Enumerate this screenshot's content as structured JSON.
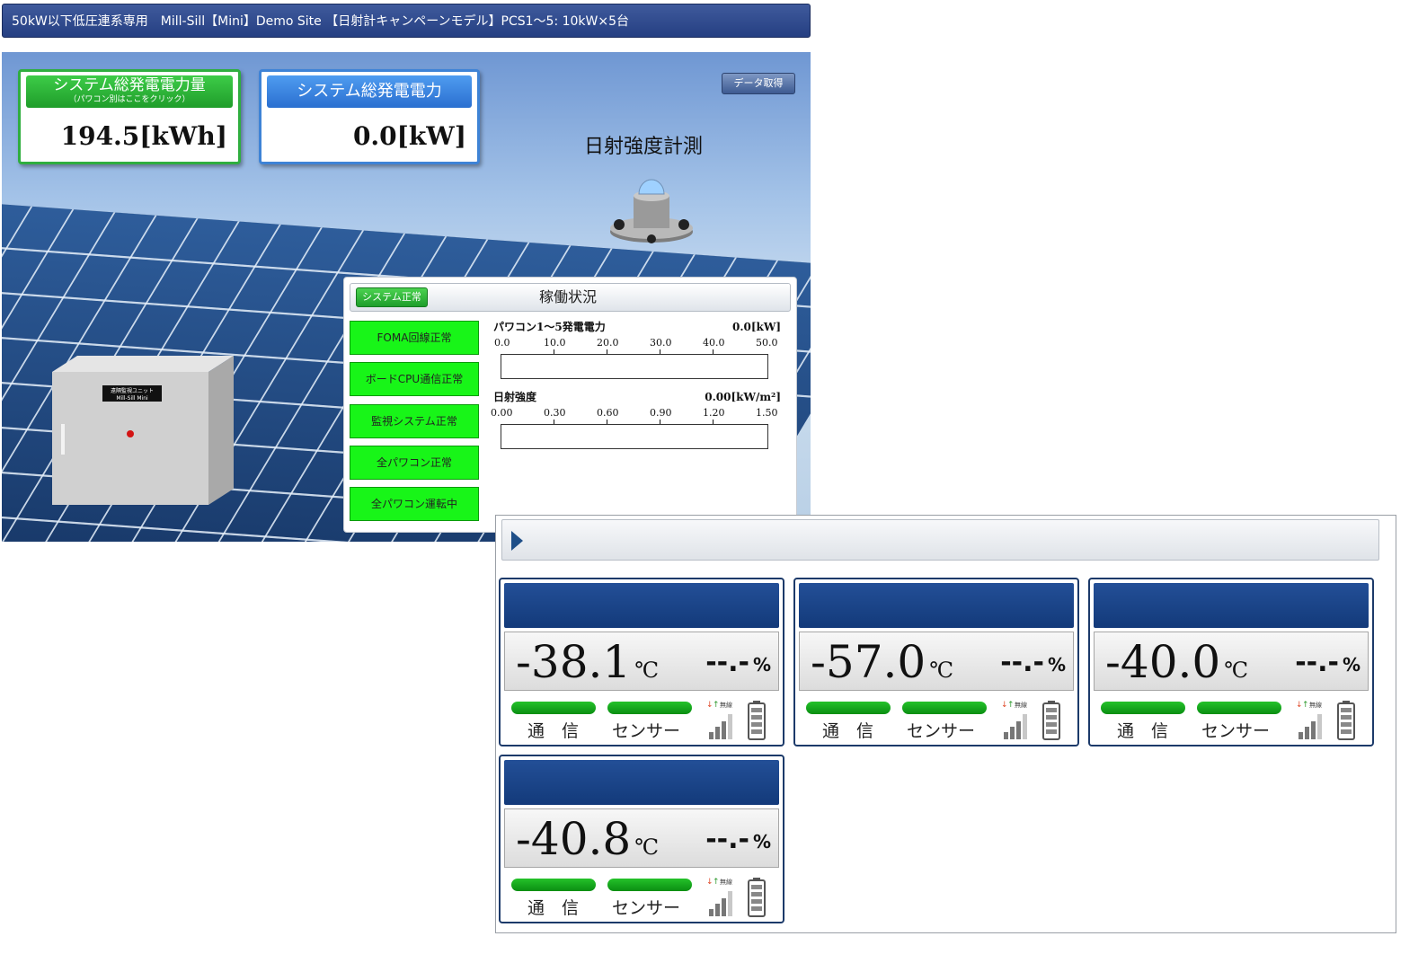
{
  "header": {
    "title": "50kW以下低圧連系専用　Mill-Sill【Mini】Demo Site 【日射計キャンペーンモデル】PCS1～5: 10kW×5台"
  },
  "summary": {
    "energy_label": "システム総発電電力量",
    "energy_sub": "（パワコン別はここをクリック）",
    "energy_value": "194.5[kWh]",
    "power_label": "システム総発電電力",
    "power_value": "0.0[kW]",
    "data_button": "データ取得",
    "irradiance_title": "日射強度計測",
    "unit_label_1": "遠隔監視ユニット",
    "unit_label_2": "Mill-Sill Mini"
  },
  "status": {
    "badge": "システム正常",
    "title": "稼働状況",
    "lights": [
      "FOMA回線正常",
      "ボードCPU通信正常",
      "監視システム正常",
      "全パワコン正常",
      "全パワコン運転中"
    ],
    "power_bar": {
      "label": "パワコン1～5発電電力",
      "value": "0.0[kW]",
      "ticks": [
        "0.0",
        "10.0",
        "20.0",
        "30.0",
        "40.0",
        "50.0"
      ],
      "fill": 0
    },
    "irradiance_bar": {
      "label": "日射強度",
      "value": "0.00[kW/m²]",
      "ticks": [
        "0.00",
        "0.30",
        "0.60",
        "0.90",
        "1.20",
        "1.50"
      ],
      "fill": 0
    }
  },
  "sensors": [
    {
      "temp": "-38.1",
      "temp_unit": "℃",
      "humidity": "--.-",
      "hum_unit": "%",
      "comm_label": "通　信",
      "sensor_label": "センサー",
      "wireless": "無線"
    },
    {
      "temp": "-57.0",
      "temp_unit": "℃",
      "humidity": "--.-",
      "hum_unit": "%",
      "comm_label": "通　信",
      "sensor_label": "センサー",
      "wireless": "無線"
    },
    {
      "temp": "-40.0",
      "temp_unit": "℃",
      "humidity": "--.-",
      "hum_unit": "%",
      "comm_label": "通　信",
      "sensor_label": "センサー",
      "wireless": "無線"
    },
    {
      "temp": "-40.8",
      "temp_unit": "℃",
      "humidity": "--.-",
      "hum_unit": "%",
      "comm_label": "通　信",
      "sensor_label": "センサー",
      "wireless": "無線"
    }
  ],
  "colors": {
    "ok_green": "#18f518",
    "header_blue": "#253f82",
    "card_blue": "#133a7a"
  }
}
